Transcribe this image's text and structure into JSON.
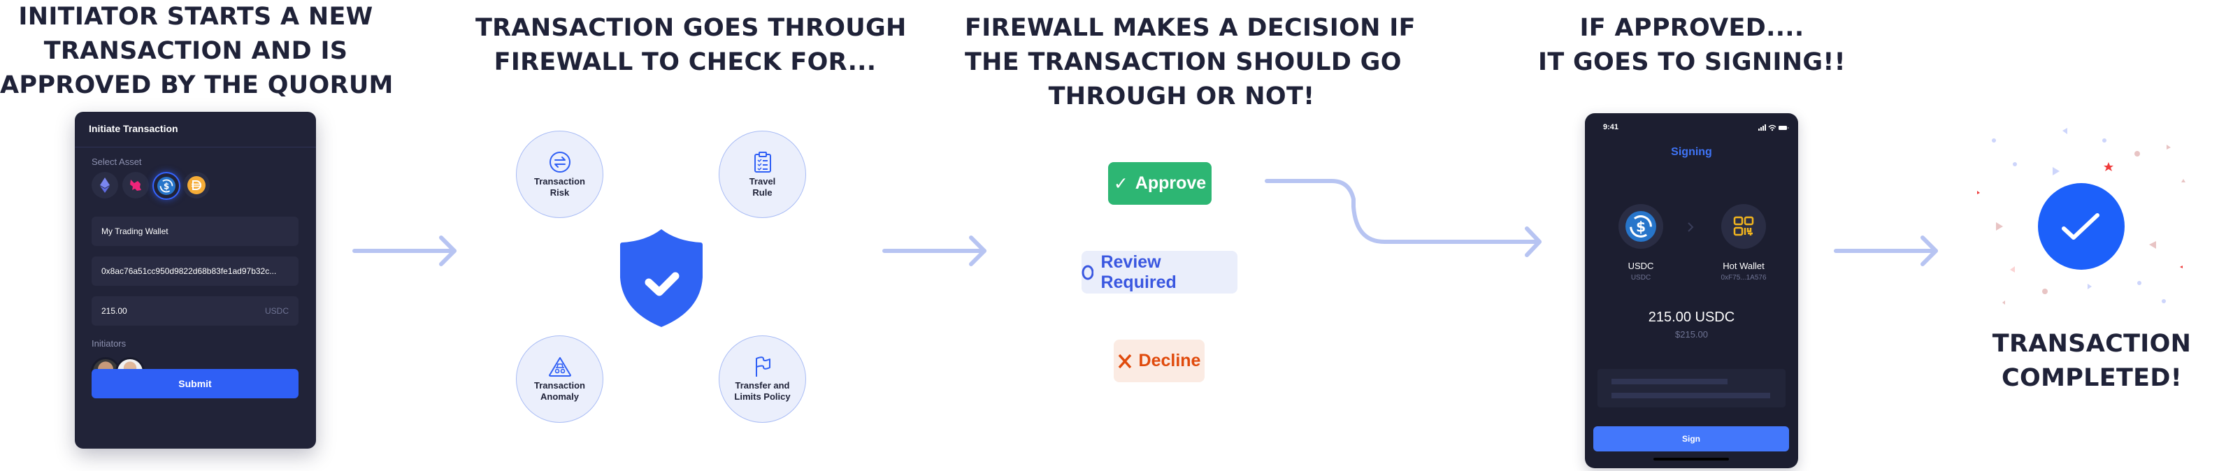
{
  "steps": [
    {
      "heading": [
        "INITIATOR STARTS A NEW",
        "TRANSACTION AND IS",
        "APPROVED BY THE QUORUM"
      ]
    },
    {
      "heading": [
        "TRANSACTION GOES THROUGH",
        "FIREWALL TO CHECK FOR..."
      ]
    },
    {
      "heading": [
        "FIREWALL MAKES A DECISION IF",
        "THE TRANSACTION SHOULD GO",
        "THROUGH OR NOT!"
      ]
    },
    {
      "heading": [
        "IF APPROVED....",
        "IT GOES TO SIGNING!!"
      ]
    },
    {
      "heading": [
        "TRANSACTION",
        "COMPLETED!"
      ]
    }
  ],
  "initiate_card": {
    "title": "Initiate Transaction",
    "select_asset_label": "Select Asset",
    "assets": [
      {
        "name": "ETH",
        "icon": "ethereum-icon",
        "selected": false
      },
      {
        "name": "UNI",
        "icon": "uniswap-icon",
        "selected": false
      },
      {
        "name": "USDC",
        "icon": "usdc-icon",
        "selected": true
      },
      {
        "name": "DAI",
        "icon": "dai-icon",
        "selected": false
      }
    ],
    "wallet_field": "My Trading Wallet",
    "address_field": "0x8ac76a51cc950d9822d68b83fe1ad97b32c...",
    "amount_field": "215.00",
    "amount_suffix": "USDC",
    "initiators_label": "Initiators",
    "initiators": [
      "initiator-1",
      "initiator-2"
    ],
    "submit_label": "Submit"
  },
  "firewall_checks": [
    {
      "label": [
        "Transaction",
        "Risk"
      ],
      "icon": "swap-icon"
    },
    {
      "label": [
        "Travel",
        "Rule"
      ],
      "icon": "clipboard-checklist-icon"
    },
    {
      "label": [
        "Transaction",
        "Anomaly"
      ],
      "icon": "incognito-alert-icon"
    },
    {
      "label": [
        "Transfer and",
        "Limits Policy"
      ],
      "icon": "flag-icon"
    }
  ],
  "decisions": {
    "approve": {
      "label": "Approve",
      "icon": "check-icon",
      "color": "#2db673"
    },
    "review": {
      "label": "Review Required",
      "icon": "circle-icon",
      "color": "#3a57e0"
    },
    "decline": {
      "label": "Decline",
      "icon": "x-icon",
      "color": "#e04a0c"
    }
  },
  "signing_phone": {
    "status_time": "9:41",
    "title": "Signing",
    "from_name": "USDC",
    "from_sub": "USDC",
    "to_name": "Hot Wallet",
    "to_sub": "0xF75...1A576",
    "amount": "215.00 USDC",
    "amount_usd": "$215.00",
    "sign_label": "Sign"
  },
  "colors": {
    "accent": "#2f5ff5",
    "arrow": "#b7c4f2",
    "heading": "#1f2238",
    "card_bg": "#212338"
  }
}
